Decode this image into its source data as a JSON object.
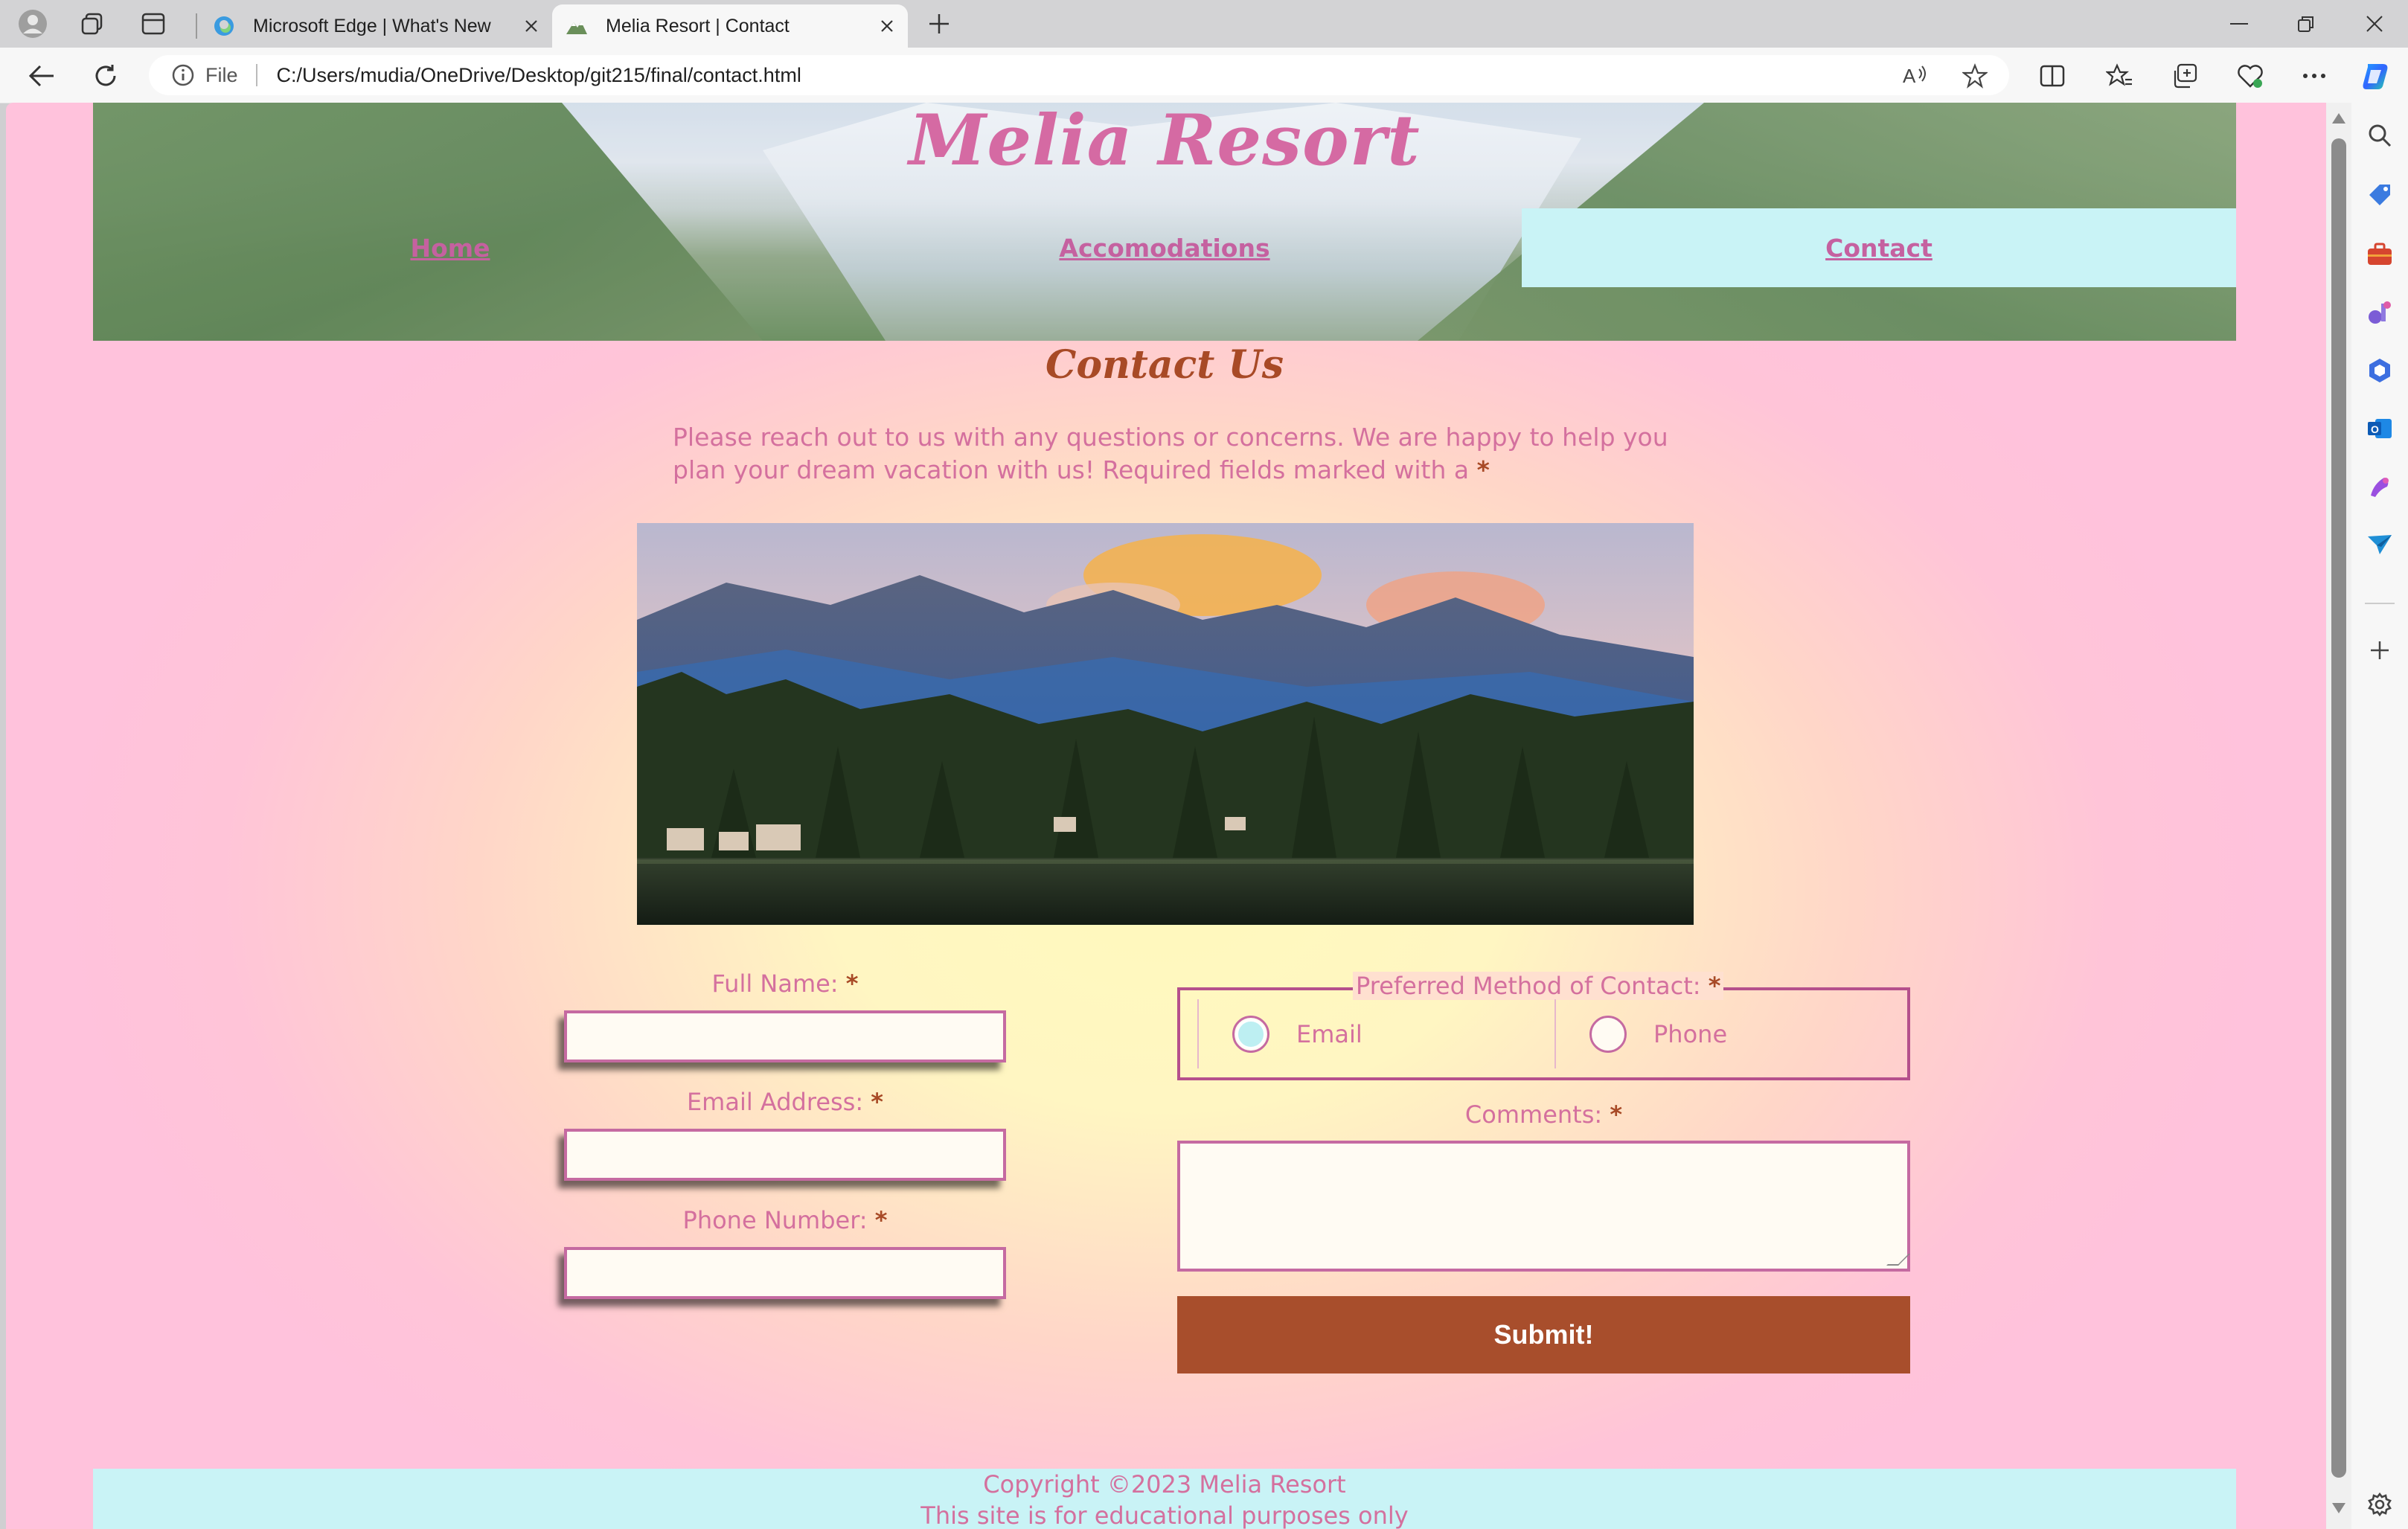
{
  "browser": {
    "tabs": [
      {
        "title": "Microsoft Edge | What's New",
        "active": false
      },
      {
        "title": "Melia Resort | Contact",
        "active": true
      }
    ],
    "address": {
      "scheme_label": "File",
      "url": "C:/Users/mudia/OneDrive/Desktop/git215/final/contact.html"
    },
    "toolbar_icons": [
      "read-aloud-icon",
      "favorite-star-icon",
      "split-screen-icon",
      "favorites-icon",
      "collections-icon",
      "browser-essentials-icon",
      "more-menu-icon",
      "copilot-icon"
    ],
    "sidebar_icons": [
      "search-icon",
      "shopping-tag-icon",
      "tools-icon",
      "games-icon",
      "office-icon",
      "outlook-icon",
      "designer-icon",
      "send-icon",
      "add-icon",
      "settings-icon"
    ]
  },
  "site": {
    "title": "Melia Resort",
    "nav": [
      {
        "label": "Home",
        "active": false
      },
      {
        "label": "Accomodations",
        "active": false
      },
      {
        "label": "Contact",
        "active": true
      }
    ],
    "heading": "Contact Us",
    "intro": "Please reach out to us with any questions or concerns. We are happy to help you plan your dream vacation with us! Required fields marked with a",
    "required_marker": "*",
    "form": {
      "full_name_label": "Full Name:",
      "email_label": "Email Address:",
      "phone_label": "Phone Number:",
      "preferred_legend": "Preferred Method of Contact:",
      "options": [
        {
          "label": "Email",
          "checked": true
        },
        {
          "label": "Phone",
          "checked": false
        }
      ],
      "comments_label": "Comments:",
      "submit_label": "Submit!"
    },
    "footer": {
      "copyright": "Copyright ©2023 Melia Resort",
      "note": "This site is for educational purposes only"
    }
  },
  "colors": {
    "accent_pink": "#d4709e",
    "heading_brown": "#a84a26",
    "nav_active_bg": "#c9f3f6",
    "submit_bg": "#a84e2c"
  }
}
